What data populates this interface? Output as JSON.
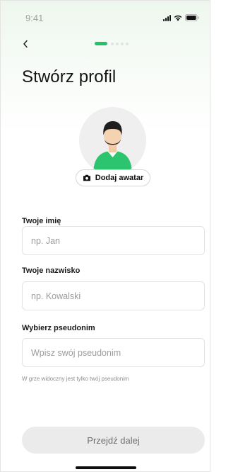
{
  "status_bar": {
    "time": "9:41",
    "icons": [
      "signal-icon",
      "wifi-icon",
      "battery-icon"
    ]
  },
  "nav": {
    "back_icon": "chevron-left-icon",
    "progress": {
      "total_steps": 5,
      "current_step": 1
    }
  },
  "page": {
    "title": "Stwórz profil"
  },
  "avatar": {
    "icon": "user-avatar-placeholder",
    "add_label": "Dodaj awatar",
    "add_icon": "camera-icon"
  },
  "form": {
    "first_name": {
      "label": "Twoje imię",
      "value": "",
      "placeholder": "np. Jan"
    },
    "last_name": {
      "label": "Twoje nazwisko",
      "value": "",
      "placeholder": "np. Kowalski"
    },
    "nickname": {
      "label": "Wybierz pseudonim",
      "value": "",
      "placeholder": "Wpisz swój pseudonim"
    },
    "hint": "W grze widoczny jest tylko twój pseudonim"
  },
  "footer": {
    "next_label": "Przejdź dalej"
  },
  "colors": {
    "accent": "#25c06b",
    "button_disabled_bg": "#ebebeb",
    "button_disabled_text": "#6f6f6f",
    "header_gradient": "#eef7ee"
  }
}
